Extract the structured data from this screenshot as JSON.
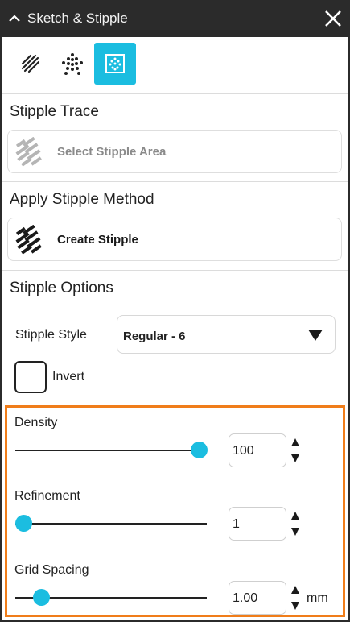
{
  "window": {
    "title": "Sketch & Stipple"
  },
  "modes": [
    {
      "icon": "sketch-icon",
      "active": false
    },
    {
      "icon": "stipple-dots-icon",
      "active": false
    },
    {
      "icon": "stipple-grid-icon",
      "active": true
    }
  ],
  "sections": {
    "stipple_trace": "Stipple Trace",
    "apply_method": "Apply Stipple Method",
    "options": "Stipple Options"
  },
  "actions": {
    "select_area": "Select Stipple Area",
    "create": "Create Stipple"
  },
  "options": {
    "style_label": "Stipple Style",
    "style_value": "Regular - 6",
    "invert_label": "Invert",
    "invert_checked": false
  },
  "sliders": [
    {
      "label": "Density",
      "value": "100",
      "fraction": 1.0,
      "unit": ""
    },
    {
      "label": "Refinement",
      "value": "1",
      "fraction": 0.0,
      "unit": ""
    },
    {
      "label": "Grid Spacing",
      "value": "1.00",
      "fraction": 0.1,
      "unit": "mm"
    }
  ],
  "colors": {
    "accent": "#1bbde0",
    "highlight": "#f07d1a",
    "titlebar": "#2b2b2b"
  }
}
